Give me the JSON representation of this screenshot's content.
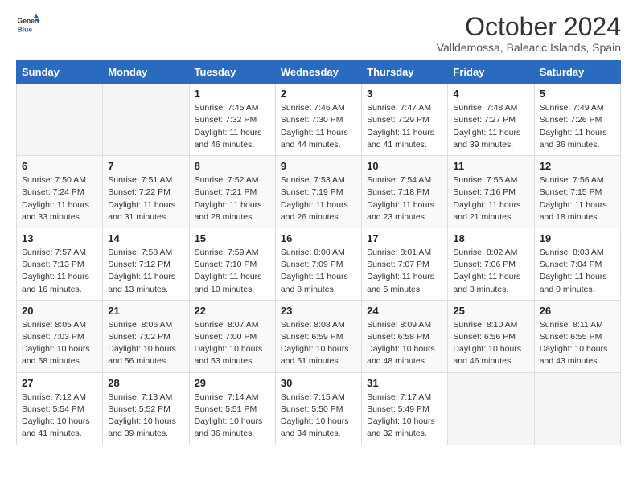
{
  "logo": {
    "line1": "General",
    "line2": "Blue"
  },
  "title": "October 2024",
  "location": "Valldemossa, Balearic Islands, Spain",
  "weekdays": [
    "Sunday",
    "Monday",
    "Tuesday",
    "Wednesday",
    "Thursday",
    "Friday",
    "Saturday"
  ],
  "weeks": [
    [
      {
        "day": "",
        "sunrise": "",
        "sunset": "",
        "daylight": ""
      },
      {
        "day": "",
        "sunrise": "",
        "sunset": "",
        "daylight": ""
      },
      {
        "day": "1",
        "sunrise": "Sunrise: 7:45 AM",
        "sunset": "Sunset: 7:32 PM",
        "daylight": "Daylight: 11 hours and 46 minutes."
      },
      {
        "day": "2",
        "sunrise": "Sunrise: 7:46 AM",
        "sunset": "Sunset: 7:30 PM",
        "daylight": "Daylight: 11 hours and 44 minutes."
      },
      {
        "day": "3",
        "sunrise": "Sunrise: 7:47 AM",
        "sunset": "Sunset: 7:29 PM",
        "daylight": "Daylight: 11 hours and 41 minutes."
      },
      {
        "day": "4",
        "sunrise": "Sunrise: 7:48 AM",
        "sunset": "Sunset: 7:27 PM",
        "daylight": "Daylight: 11 hours and 39 minutes."
      },
      {
        "day": "5",
        "sunrise": "Sunrise: 7:49 AM",
        "sunset": "Sunset: 7:26 PM",
        "daylight": "Daylight: 11 hours and 36 minutes."
      }
    ],
    [
      {
        "day": "6",
        "sunrise": "Sunrise: 7:50 AM",
        "sunset": "Sunset: 7:24 PM",
        "daylight": "Daylight: 11 hours and 33 minutes."
      },
      {
        "day": "7",
        "sunrise": "Sunrise: 7:51 AM",
        "sunset": "Sunset: 7:22 PM",
        "daylight": "Daylight: 11 hours and 31 minutes."
      },
      {
        "day": "8",
        "sunrise": "Sunrise: 7:52 AM",
        "sunset": "Sunset: 7:21 PM",
        "daylight": "Daylight: 11 hours and 28 minutes."
      },
      {
        "day": "9",
        "sunrise": "Sunrise: 7:53 AM",
        "sunset": "Sunset: 7:19 PM",
        "daylight": "Daylight: 11 hours and 26 minutes."
      },
      {
        "day": "10",
        "sunrise": "Sunrise: 7:54 AM",
        "sunset": "Sunset: 7:18 PM",
        "daylight": "Daylight: 11 hours and 23 minutes."
      },
      {
        "day": "11",
        "sunrise": "Sunrise: 7:55 AM",
        "sunset": "Sunset: 7:16 PM",
        "daylight": "Daylight: 11 hours and 21 minutes."
      },
      {
        "day": "12",
        "sunrise": "Sunrise: 7:56 AM",
        "sunset": "Sunset: 7:15 PM",
        "daylight": "Daylight: 11 hours and 18 minutes."
      }
    ],
    [
      {
        "day": "13",
        "sunrise": "Sunrise: 7:57 AM",
        "sunset": "Sunset: 7:13 PM",
        "daylight": "Daylight: 11 hours and 16 minutes."
      },
      {
        "day": "14",
        "sunrise": "Sunrise: 7:58 AM",
        "sunset": "Sunset: 7:12 PM",
        "daylight": "Daylight: 11 hours and 13 minutes."
      },
      {
        "day": "15",
        "sunrise": "Sunrise: 7:59 AM",
        "sunset": "Sunset: 7:10 PM",
        "daylight": "Daylight: 11 hours and 10 minutes."
      },
      {
        "day": "16",
        "sunrise": "Sunrise: 8:00 AM",
        "sunset": "Sunset: 7:09 PM",
        "daylight": "Daylight: 11 hours and 8 minutes."
      },
      {
        "day": "17",
        "sunrise": "Sunrise: 8:01 AM",
        "sunset": "Sunset: 7:07 PM",
        "daylight": "Daylight: 11 hours and 5 minutes."
      },
      {
        "day": "18",
        "sunrise": "Sunrise: 8:02 AM",
        "sunset": "Sunset: 7:06 PM",
        "daylight": "Daylight: 11 hours and 3 minutes."
      },
      {
        "day": "19",
        "sunrise": "Sunrise: 8:03 AM",
        "sunset": "Sunset: 7:04 PM",
        "daylight": "Daylight: 11 hours and 0 minutes."
      }
    ],
    [
      {
        "day": "20",
        "sunrise": "Sunrise: 8:05 AM",
        "sunset": "Sunset: 7:03 PM",
        "daylight": "Daylight: 10 hours and 58 minutes."
      },
      {
        "day": "21",
        "sunrise": "Sunrise: 8:06 AM",
        "sunset": "Sunset: 7:02 PM",
        "daylight": "Daylight: 10 hours and 56 minutes."
      },
      {
        "day": "22",
        "sunrise": "Sunrise: 8:07 AM",
        "sunset": "Sunset: 7:00 PM",
        "daylight": "Daylight: 10 hours and 53 minutes."
      },
      {
        "day": "23",
        "sunrise": "Sunrise: 8:08 AM",
        "sunset": "Sunset: 6:59 PM",
        "daylight": "Daylight: 10 hours and 51 minutes."
      },
      {
        "day": "24",
        "sunrise": "Sunrise: 8:09 AM",
        "sunset": "Sunset: 6:58 PM",
        "daylight": "Daylight: 10 hours and 48 minutes."
      },
      {
        "day": "25",
        "sunrise": "Sunrise: 8:10 AM",
        "sunset": "Sunset: 6:56 PM",
        "daylight": "Daylight: 10 hours and 46 minutes."
      },
      {
        "day": "26",
        "sunrise": "Sunrise: 8:11 AM",
        "sunset": "Sunset: 6:55 PM",
        "daylight": "Daylight: 10 hours and 43 minutes."
      }
    ],
    [
      {
        "day": "27",
        "sunrise": "Sunrise: 7:12 AM",
        "sunset": "Sunset: 5:54 PM",
        "daylight": "Daylight: 10 hours and 41 minutes."
      },
      {
        "day": "28",
        "sunrise": "Sunrise: 7:13 AM",
        "sunset": "Sunset: 5:52 PM",
        "daylight": "Daylight: 10 hours and 39 minutes."
      },
      {
        "day": "29",
        "sunrise": "Sunrise: 7:14 AM",
        "sunset": "Sunset: 5:51 PM",
        "daylight": "Daylight: 10 hours and 36 minutes."
      },
      {
        "day": "30",
        "sunrise": "Sunrise: 7:15 AM",
        "sunset": "Sunset: 5:50 PM",
        "daylight": "Daylight: 10 hours and 34 minutes."
      },
      {
        "day": "31",
        "sunrise": "Sunrise: 7:17 AM",
        "sunset": "Sunset: 5:49 PM",
        "daylight": "Daylight: 10 hours and 32 minutes."
      },
      {
        "day": "",
        "sunrise": "",
        "sunset": "",
        "daylight": ""
      },
      {
        "day": "",
        "sunrise": "",
        "sunset": "",
        "daylight": ""
      }
    ]
  ]
}
